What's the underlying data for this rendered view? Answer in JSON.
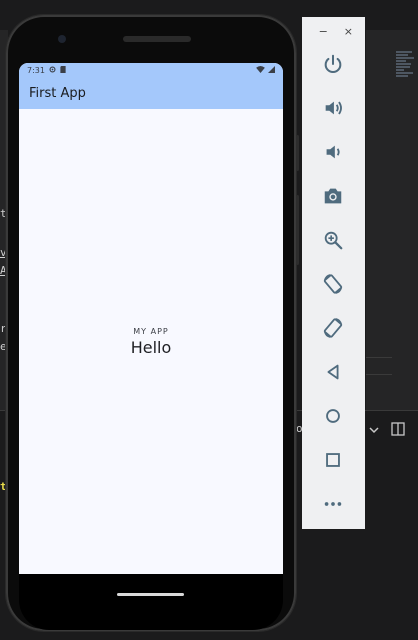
{
  "ide": {
    "left_chars": [
      "t",
      "v",
      "A",
      "r",
      "e",
      "t"
    ],
    "right_chars": [
      "o"
    ]
  },
  "phone": {
    "status": {
      "time": "7:31"
    },
    "app_bar": {
      "title": "First App"
    },
    "content": {
      "caption": "MY APP",
      "greeting": "Hello"
    }
  },
  "toolbar": {
    "window_controls": {
      "minimize": "−",
      "close": "×"
    },
    "buttons": [
      {
        "name": "power-icon"
      },
      {
        "name": "volume-up-icon"
      },
      {
        "name": "volume-down-icon"
      },
      {
        "name": "camera-icon"
      },
      {
        "name": "zoom-icon"
      },
      {
        "name": "rotate-left-icon"
      },
      {
        "name": "rotate-right-icon"
      },
      {
        "name": "back-icon"
      },
      {
        "name": "home-icon"
      },
      {
        "name": "overview-icon"
      },
      {
        "name": "more-icon"
      }
    ],
    "icon_color": "#4f6b7e"
  },
  "colors": {
    "app_bar": "#a4c8fb",
    "screen_background": "#f8f9ff",
    "ide_background": "#1b1b1c"
  }
}
